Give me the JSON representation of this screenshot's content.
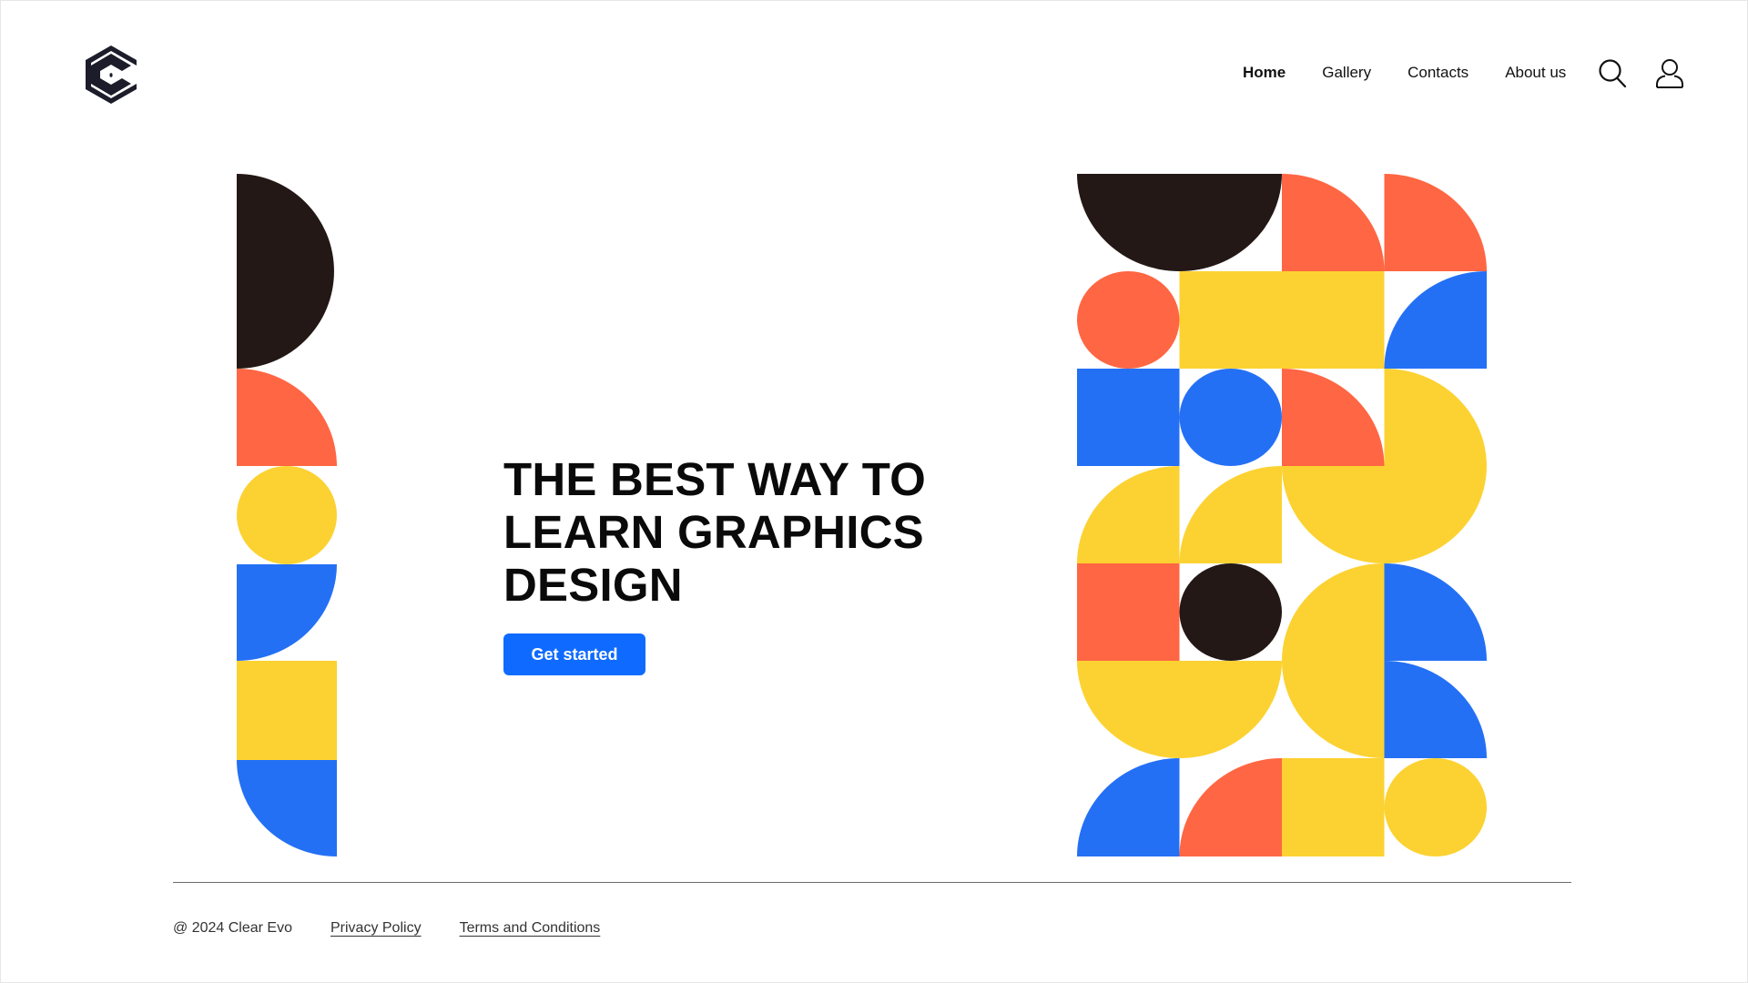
{
  "brand": {
    "logo_icon": "hexagon-c-logo-icon",
    "color": "#1c1c2a"
  },
  "nav": {
    "items": [
      {
        "label": "Home",
        "active": true
      },
      {
        "label": "Gallery",
        "active": false
      },
      {
        "label": "Contacts",
        "active": false
      },
      {
        "label": "About us",
        "active": false
      }
    ],
    "search_icon": "search-icon",
    "account_icon": "user-icon"
  },
  "hero": {
    "title_lines": [
      "THE BEST WAY TO",
      "LEARN GRAPHICS",
      "DESIGN"
    ],
    "cta_label": "Get started",
    "cta_color": "#0f6bff"
  },
  "palette": {
    "black": "#231815",
    "orange": "#ff6643",
    "yellow": "#fcd232",
    "blue": "#2470f5"
  },
  "footer": {
    "copyright": "@ 2024 Clear Evo",
    "links": [
      "Privacy Policy",
      "Terms and Conditions"
    ]
  }
}
